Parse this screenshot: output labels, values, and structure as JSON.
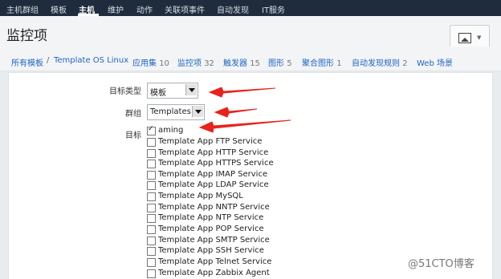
{
  "topnav": {
    "items": [
      "主机群组",
      "模板",
      "主机",
      "维护",
      "动作",
      "关联项事件",
      "自动发现",
      "IT服务"
    ]
  },
  "header": {
    "title": "监控项"
  },
  "breadcrumbs": {
    "all_templates": "所有模板",
    "separator": "/",
    "template": "Template OS Linux",
    "links": [
      {
        "label": "应用集",
        "count": "10"
      },
      {
        "label": "监控项",
        "count": "32"
      },
      {
        "label": "触发器",
        "count": "15"
      },
      {
        "label": "图形",
        "count": "5"
      },
      {
        "label": "聚合图形",
        "count": "1"
      },
      {
        "label": "自动发现规则",
        "count": "2"
      },
      {
        "label": "Web 场景",
        "count": ""
      }
    ]
  },
  "form": {
    "target_type_label": "目标类型",
    "target_type_value": "模板",
    "group_label": "群组",
    "group_value": "Templates",
    "target_label": "目标",
    "targets": [
      {
        "name": "aming",
        "checked": true
      },
      {
        "name": "Template App FTP Service",
        "checked": false
      },
      {
        "name": "Template App HTTP Service",
        "checked": false
      },
      {
        "name": "Template App HTTPS Service",
        "checked": false
      },
      {
        "name": "Template App IMAP Service",
        "checked": false
      },
      {
        "name": "Template App LDAP Service",
        "checked": false
      },
      {
        "name": "Template App MySQL",
        "checked": false
      },
      {
        "name": "Template App NNTP Service",
        "checked": false
      },
      {
        "name": "Template App NTP Service",
        "checked": false
      },
      {
        "name": "Template App POP Service",
        "checked": false
      },
      {
        "name": "Template App SMTP Service",
        "checked": false
      },
      {
        "name": "Template App SSH Service",
        "checked": false
      },
      {
        "name": "Template App Telnet Service",
        "checked": false
      },
      {
        "name": "Template App Zabbix Agent",
        "checked": false
      }
    ]
  },
  "watermark": "@51CTO博客",
  "colors": {
    "topnav_bg": "#1f2c3d",
    "link": "#1f65c4",
    "arrow": "#e8231c"
  }
}
